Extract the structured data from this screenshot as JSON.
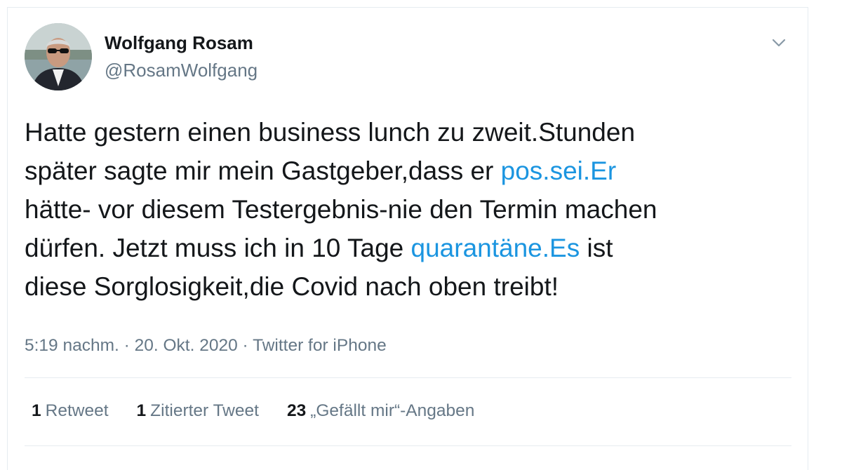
{
  "author": {
    "name": "Wolfgang Rosam",
    "handle": "@RosamWolfgang"
  },
  "tweet": {
    "line1": "Hatte gestern einen business lunch zu zweit.Stunden",
    "line2_pre": "später sagte mir mein Gastgeber,dass er ",
    "line2_link": "pos.sei.Er",
    "line3": "hätte- vor diesem Testergebnis-nie den Termin machen",
    "line4_pre": "dürfen. Jetzt muss ich in 10 Tage ",
    "line4_link": "quarantäne.Es",
    "line4_post": " ist",
    "line5": "diese Sorglosigkeit,die Covid nach oben treibt!"
  },
  "meta": {
    "time": "5:19 nachm.",
    "sep": " · ",
    "date": "20. Okt. 2020",
    "source": "Twitter for iPhone"
  },
  "stats": {
    "retweets_count": "1",
    "retweets_label": "Retweet",
    "quotes_count": "1",
    "quotes_label": "Zitierter Tweet",
    "likes_count": "23",
    "likes_label": "„Gefällt mir“-Angaben"
  },
  "icons": {
    "menu": "chevron-down-icon",
    "avatar": "profile-photo"
  },
  "colors": {
    "link": "#1b95e0",
    "secondary": "#657786",
    "primary": "#14171a",
    "border": "#e6ecf0"
  }
}
